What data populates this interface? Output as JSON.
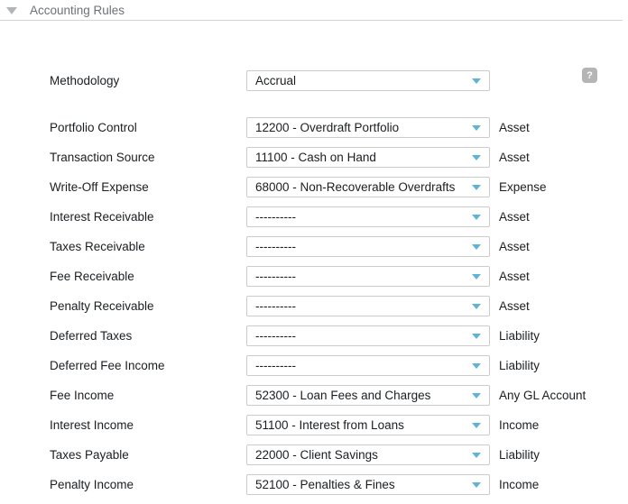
{
  "section": {
    "title": "Accounting Rules"
  },
  "icons": {
    "collapse_icon": "triangle-down",
    "help_icon_glyph": "?",
    "dropdown_icon": "triangle-down"
  },
  "colors": {
    "dropdown_arrow": "#5fb3d6",
    "header_text": "#6d7278",
    "divider": "#d4d4d4",
    "help_badge_bg": "#b5b5b5",
    "field_text": "#1b1e21"
  },
  "rows": [
    {
      "label": "Methodology",
      "value": "Accrual",
      "type": ""
    },
    {
      "label": "Portfolio Control",
      "value": "12200 - Overdraft Portfolio",
      "type": "Asset"
    },
    {
      "label": "Transaction Source",
      "value": "11100 - Cash on Hand",
      "type": "Asset"
    },
    {
      "label": "Write-Off Expense",
      "value": "68000 - Non-Recoverable Overdrafts",
      "type": "Expense"
    },
    {
      "label": "Interest Receivable",
      "value": "----------",
      "type": "Asset"
    },
    {
      "label": "Taxes Receivable",
      "value": "----------",
      "type": "Asset"
    },
    {
      "label": "Fee Receivable",
      "value": "----------",
      "type": "Asset"
    },
    {
      "label": "Penalty Receivable",
      "value": "----------",
      "type": "Asset"
    },
    {
      "label": "Deferred Taxes",
      "value": "----------",
      "type": "Liability"
    },
    {
      "label": "Deferred Fee Income",
      "value": "----------",
      "type": "Liability"
    },
    {
      "label": "Fee Income",
      "value": "52300 - Loan Fees and Charges",
      "type": "Any GL Account"
    },
    {
      "label": "Interest Income",
      "value": "51100 - Interest from Loans",
      "type": "Income"
    },
    {
      "label": "Taxes Payable",
      "value": "22000 - Client Savings",
      "type": "Liability"
    },
    {
      "label": "Penalty Income",
      "value": "52100 - Penalties & Fines",
      "type": "Income"
    }
  ]
}
